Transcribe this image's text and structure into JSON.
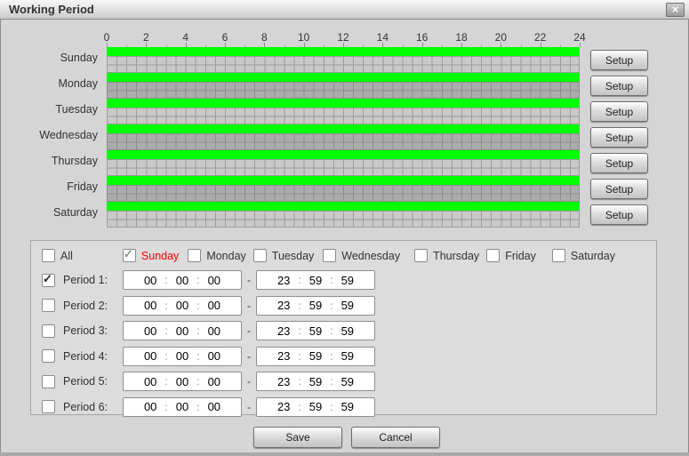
{
  "window": {
    "title": "Working Period"
  },
  "icons": {
    "close": "×",
    "check": "✓",
    "time_colon": ":",
    "range_separator": "-"
  },
  "colors": {
    "active_bar": "#00ff00",
    "highlight_day": "#ff0000"
  },
  "timeline": {
    "hour_labels": [
      "0",
      "2",
      "4",
      "6",
      "8",
      "10",
      "12",
      "14",
      "16",
      "18",
      "20",
      "22",
      "24"
    ],
    "days": [
      {
        "name": "Sunday",
        "setup_label": "Setup",
        "active_range": "0-24"
      },
      {
        "name": "Monday",
        "setup_label": "Setup",
        "active_range": "0-24"
      },
      {
        "name": "Tuesday",
        "setup_label": "Setup",
        "active_range": "0-24"
      },
      {
        "name": "Wednesday",
        "setup_label": "Setup",
        "active_range": "0-24"
      },
      {
        "name": "Thursday",
        "setup_label": "Setup",
        "active_range": "0-24"
      },
      {
        "name": "Friday",
        "setup_label": "Setup",
        "active_range": "0-24"
      },
      {
        "name": "Saturday",
        "setup_label": "Setup",
        "active_range": "0-24"
      }
    ]
  },
  "day_select": {
    "all_label": "All",
    "all_checked": false,
    "days": [
      {
        "label": "Sunday",
        "checked": true,
        "highlight": true
      },
      {
        "label": "Monday",
        "checked": false
      },
      {
        "label": "Tuesday",
        "checked": false
      },
      {
        "label": "Wednesday",
        "checked": false
      },
      {
        "label": "Thursday",
        "checked": false
      },
      {
        "label": "Friday",
        "checked": false
      },
      {
        "label": "Saturday",
        "checked": false
      }
    ]
  },
  "periods": [
    {
      "label": "Period 1:",
      "checked": true,
      "start": {
        "h": "00",
        "m": "00",
        "s": "00"
      },
      "end": {
        "h": "23",
        "m": "59",
        "s": "59"
      }
    },
    {
      "label": "Period 2:",
      "checked": false,
      "start": {
        "h": "00",
        "m": "00",
        "s": "00"
      },
      "end": {
        "h": "23",
        "m": "59",
        "s": "59"
      }
    },
    {
      "label": "Period 3:",
      "checked": false,
      "start": {
        "h": "00",
        "m": "00",
        "s": "00"
      },
      "end": {
        "h": "23",
        "m": "59",
        "s": "59"
      }
    },
    {
      "label": "Period 4:",
      "checked": false,
      "start": {
        "h": "00",
        "m": "00",
        "s": "00"
      },
      "end": {
        "h": "23",
        "m": "59",
        "s": "59"
      }
    },
    {
      "label": "Period 5:",
      "checked": false,
      "start": {
        "h": "00",
        "m": "00",
        "s": "00"
      },
      "end": {
        "h": "23",
        "m": "59",
        "s": "59"
      }
    },
    {
      "label": "Period 6:",
      "checked": false,
      "start": {
        "h": "00",
        "m": "00",
        "s": "00"
      },
      "end": {
        "h": "23",
        "m": "59",
        "s": "59"
      }
    }
  ],
  "footer": {
    "save_label": "Save",
    "cancel_label": "Cancel"
  }
}
